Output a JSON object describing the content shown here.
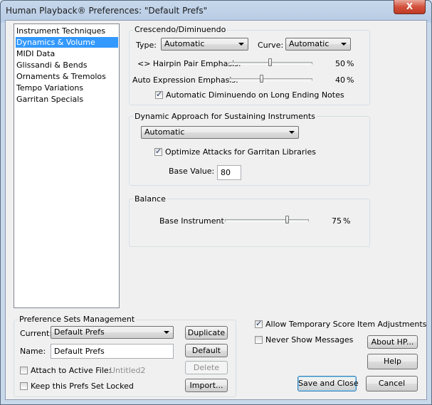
{
  "window": {
    "title": "Human Playback® Preferences: \"Default Prefs\"",
    "close_glyph": "X"
  },
  "sidebar": {
    "items": [
      {
        "label": "Instrument Techniques",
        "selected": false
      },
      {
        "label": "Dynamics & Volume",
        "selected": true
      },
      {
        "label": "MIDI Data",
        "selected": false
      },
      {
        "label": "Glissandi & Bends",
        "selected": false
      },
      {
        "label": "Ornaments & Tremolos",
        "selected": false
      },
      {
        "label": "Tempo Variations",
        "selected": false
      },
      {
        "label": "Garritan Specials",
        "selected": false
      }
    ]
  },
  "crescendo": {
    "group_label": "Crescendo/Diminuendo",
    "type_label": "Type:",
    "type_value": "Automatic",
    "curve_label": "Curve:",
    "curve_value": "Automatic",
    "hairpin_label": "<> Hairpin Pair Emphasis:",
    "hairpin_value": 50,
    "hairpin_text": "50",
    "hairpin_unit": "%",
    "auto_expr_label": "Auto Expression Emphasis:",
    "auto_expr_value": 40,
    "auto_expr_text": "40",
    "auto_expr_unit": "%",
    "auto_dim_label": "Automatic Diminuendo on Long Ending Notes",
    "auto_dim_checked": true
  },
  "sustain": {
    "group_label": "Dynamic Approach for Sustaining Instruments",
    "approach_value": "Automatic",
    "optimize_label": "Optimize Attacks for Garritan Libraries",
    "optimize_checked": true,
    "base_value_label": "Base Value:",
    "base_value": "80"
  },
  "balance": {
    "group_label": "Balance",
    "base_instrument_label": "Base Instrument",
    "base_instrument_value": 75,
    "base_instrument_text": "75",
    "base_instrument_unit": "%"
  },
  "prefsets": {
    "group_label": "Preference Sets Management",
    "current_label": "Current:",
    "current_value": "Default Prefs",
    "name_label": "Name:",
    "name_value": "Default Prefs",
    "attach_label": "Attach to Active File:",
    "attach_file": "Untitled2",
    "attach_checked": false,
    "locked_label": "Keep this Prefs Set Locked",
    "locked_checked": false,
    "duplicate_label": "Duplicate",
    "default_label": "Default",
    "delete_label": "Delete",
    "import_label": "Import..."
  },
  "options": {
    "allow_temp_label": "Allow Temporary Score Item Adjustments",
    "allow_temp_checked": true,
    "never_show_label": "Never Show Messages",
    "never_show_checked": false
  },
  "buttons": {
    "about": "About HP...",
    "help": "Help",
    "save_close": "Save and Close",
    "cancel": "Cancel"
  }
}
